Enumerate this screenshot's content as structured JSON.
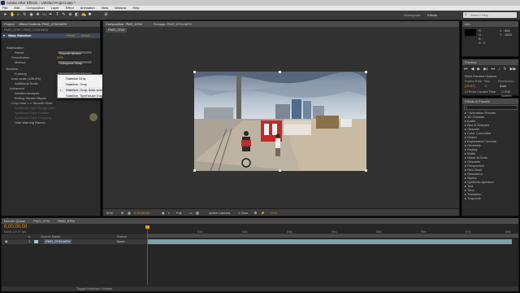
{
  "window": {
    "title": "Adobe After Effects - Untitled Project.aep *"
  },
  "menu": [
    "File",
    "Edit",
    "Composition",
    "Layer",
    "Effect",
    "Animation",
    "View",
    "Window",
    "Help"
  ],
  "toolbar": {
    "workspace_label": "Workspace:",
    "workspace_value": "Effects",
    "search_placeholder": "Search Help"
  },
  "left_panel": {
    "tabs": [
      "Project",
      "Effect Controls: PMO_0704.MOV"
    ],
    "breadcrumb": "PMO_0704 • PMO_0704.MOV",
    "effect_name": "Warp Stabilizer",
    "reset_label": "Reset",
    "about_label": "About...",
    "rows": [
      {
        "label": "Stabilization",
        "value": ""
      },
      {
        "label": "Result",
        "value": "Smooth Motion"
      },
      {
        "label": "Smoothness",
        "value": "50%"
      },
      {
        "label": "Method",
        "value": "Subspace Warp"
      },
      {
        "label": "Borders",
        "value": ""
      },
      {
        "label": "Framing",
        "value": "Stabilize, Crop, Auto-sc"
      },
      {
        "label": "Auto-scale (105.8%)",
        "value": ""
      },
      {
        "label": "Additional Scale",
        "value": ""
      },
      {
        "label": "Advanced",
        "value": ""
      },
      {
        "label": "Detailed Analysis",
        "value": ""
      },
      {
        "label": "Rolling Shutter Ripple",
        "value": ""
      },
      {
        "label": "Crop Less <-> Smooth More",
        "value": ""
      },
      {
        "label": "Synthesis Input Range (sec)",
        "value": ""
      },
      {
        "label": "Synthesis Edge Feather",
        "value": ""
      },
      {
        "label": "Synthesis Edge Cropping",
        "value": ""
      },
      {
        "label": "Hide Warning Banner",
        "value": ""
      }
    ],
    "framing_dropdown": {
      "options": [
        "Stabilize Only",
        "Stabilize, Crop",
        "Stabilize, Crop, Auto-scale",
        "Stabilize, Synthesize Edges"
      ],
      "selected": "Stabilize, Crop, Auto-scale"
    }
  },
  "composition_panel": {
    "tabs": [
      "Composition: PMO_0704",
      "Footage: PMO_0704.MOV"
    ],
    "comp_tab": "PMO_0704",
    "zoom": "50%",
    "timecode": "0;00;00;00",
    "resolution": "Full",
    "camera": "Active Camera",
    "views": "1 View",
    "exposure": "+0.0"
  },
  "right_panels": {
    "info_tab": "Info",
    "info_lines": [
      "R :",
      "G :",
      "B :",
      "A : 0",
      "X : 888",
      "Y : 1600"
    ],
    "preview_tab": "Preview",
    "ram_preview_label": "RAM Preview Options",
    "frame_rate_label": "Frame Rate",
    "skip_label": "Skip",
    "resolution_label": "Resolution",
    "frame_rate_value": "(29.97)",
    "skip_value": "0",
    "resolution_value": "Auto",
    "from_current_time": "From Current Time",
    "full_screen": "Full Screen",
    "effects_tab": "Effects & Presets",
    "effects_search_placeholder": "",
    "effects": [
      "* Animation Presets",
      "3D Channel",
      "Audio",
      "Blur & Sharpen",
      "Channel",
      "Color Correction",
      "Distort",
      "Expression Controls",
      "Generate",
      "Keying",
      "Matte",
      "Noise & Grain",
      "Obsolete",
      "Perspective",
      "Red Giant",
      "Simulation",
      "Stylize",
      "Synthetic Aperture",
      "Text",
      "Time",
      "Transition",
      "Trapcode"
    ]
  },
  "timeline": {
    "tabs": [
      "Render Queue",
      "PMO_0704",
      "PMO_0704"
    ],
    "timecode": "0;00;00;00",
    "frame_info": "00000 (29.97 fps)",
    "columns": [
      "#",
      "Source Name",
      "Parent"
    ],
    "layers": [
      {
        "num": "1",
        "name": "PMO_0704.MOV",
        "parent": "None"
      }
    ],
    "ticks": [
      "01s",
      "02s",
      "03s",
      "04s",
      "05s",
      "06s",
      "07s",
      "08s"
    ],
    "bottom_label": "Toggle Switches / Modes"
  },
  "colors": {
    "accent": "#e69a1c",
    "panel": "#2b2b2b",
    "header": "#4a4a4a",
    "playhead": "#d02828",
    "layer_bar": "#7fa3a8"
  }
}
